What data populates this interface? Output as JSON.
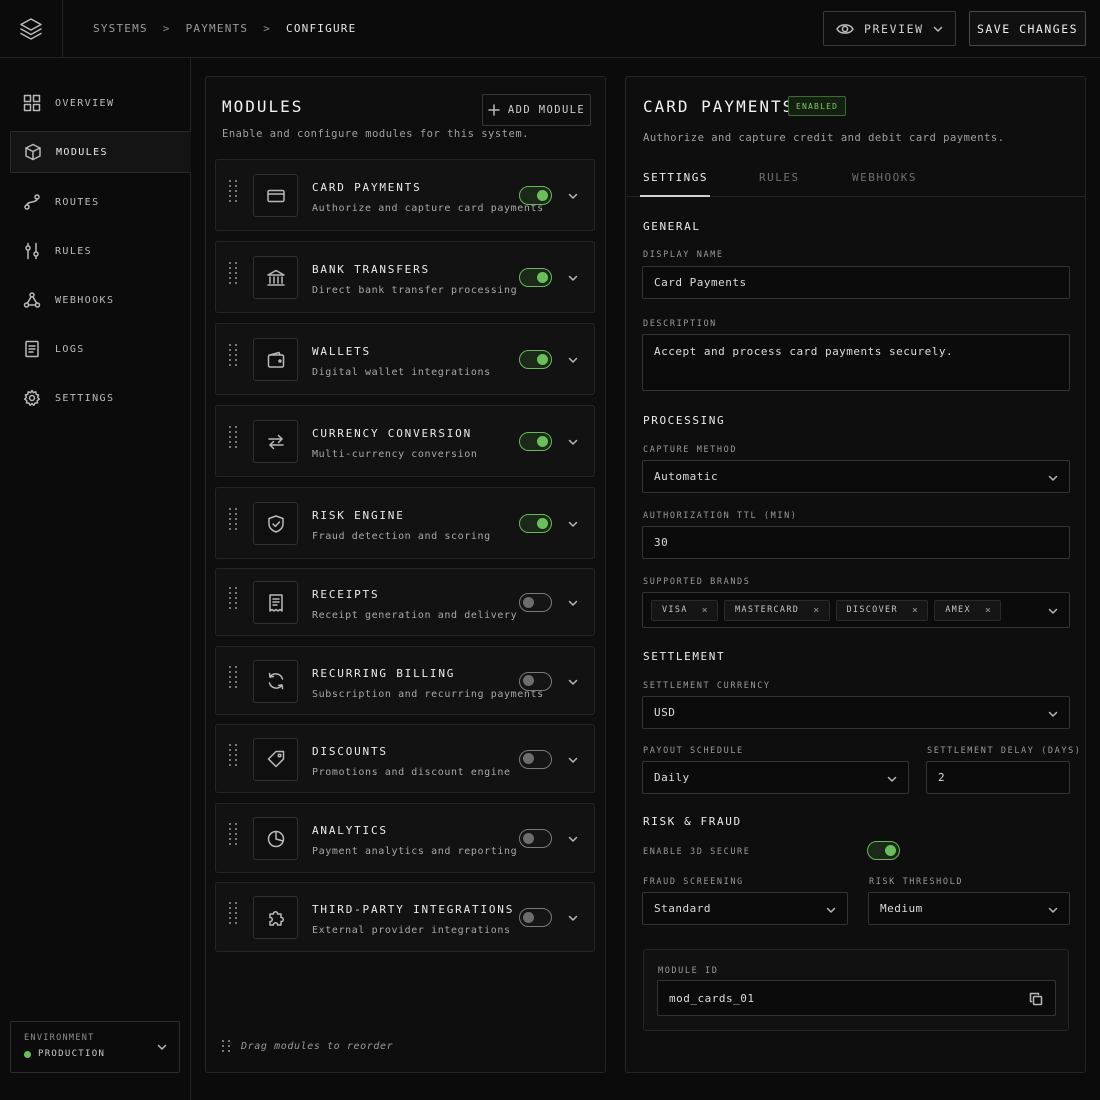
{
  "breadcrumb": [
    "SYSTEMS",
    "PAYMENTS",
    "CONFIGURE"
  ],
  "breadcrumb_sep": ">",
  "header": {
    "preview_label": "PREVIEW",
    "save_label": "SAVE CHANGES"
  },
  "sidebar": {
    "items": [
      {
        "label": "OVERVIEW",
        "icon": "grid-icon"
      },
      {
        "label": "MODULES",
        "icon": "cube-icon"
      },
      {
        "label": "ROUTES",
        "icon": "route-icon"
      },
      {
        "label": "RULES",
        "icon": "sliders-icon"
      },
      {
        "label": "WEBHOOKS",
        "icon": "webhook-icon"
      },
      {
        "label": "LOGS",
        "icon": "document-icon"
      },
      {
        "label": "SETTINGS",
        "icon": "gear-icon"
      }
    ],
    "environment_label": "ENVIRONMENT",
    "environment_value": "PRODUCTION",
    "environment_status_color": "#6bbf59"
  },
  "modules": {
    "title": "MODULES",
    "subtitle": "Enable and configure modules for this system.",
    "add_label": "ADD MODULE",
    "hint": "Drag modules to reorder",
    "items": [
      {
        "name": "CARD PAYMENTS",
        "desc": "Authorize and capture card payments",
        "enabled": true,
        "icon": "credit-card-icon"
      },
      {
        "name": "BANK TRANSFERS",
        "desc": "Direct bank transfer processing",
        "enabled": true,
        "icon": "bank-icon"
      },
      {
        "name": "WALLETS",
        "desc": "Digital wallet integrations",
        "enabled": true,
        "icon": "wallet-icon"
      },
      {
        "name": "CURRENCY CONVERSION",
        "desc": "Multi-currency conversion",
        "enabled": true,
        "icon": "swap-arrows-icon"
      },
      {
        "name": "RISK ENGINE",
        "desc": "Fraud detection and scoring",
        "enabled": true,
        "icon": "shield-check-icon"
      },
      {
        "name": "RECEIPTS",
        "desc": "Receipt generation and delivery",
        "enabled": false,
        "icon": "receipt-icon"
      },
      {
        "name": "RECURRING BILLING",
        "desc": "Subscription and recurring payments",
        "enabled": false,
        "icon": "refresh-icon"
      },
      {
        "name": "DISCOUNTS",
        "desc": "Promotions and discount engine",
        "enabled": false,
        "icon": "tag-icon"
      },
      {
        "name": "ANALYTICS",
        "desc": "Payment analytics and reporting",
        "enabled": false,
        "icon": "pie-chart-icon"
      },
      {
        "name": "THIRD-PARTY INTEGRATIONS",
        "desc": "External provider integrations",
        "enabled": false,
        "icon": "puzzle-icon"
      }
    ]
  },
  "details": {
    "title": "CARD PAYMENTS",
    "badge": "ENABLED",
    "subtitle": "Authorize and capture credit and debit card payments.",
    "tabs": [
      "SETTINGS",
      "RULES",
      "WEBHOOKS"
    ],
    "general": {
      "section": "GENERAL",
      "display_name_label": "DISPLAY NAME",
      "display_name_value": "Card Payments",
      "description_label": "DESCRIPTION",
      "description_value": "Accept and process card payments securely."
    },
    "processing": {
      "section": "PROCESSING",
      "capture_label": "CAPTURE METHOD",
      "capture_value": "Automatic",
      "ttl_label": "AUTHORIZATION TTL (MIN)",
      "ttl_value": "30",
      "brands_label": "SUPPORTED BRANDS",
      "brands": [
        "VISA",
        "MASTERCARD",
        "DISCOVER",
        "AMEX"
      ]
    },
    "settlement": {
      "section": "SETTLEMENT",
      "currency_label": "SETTLEMENT CURRENCY",
      "currency_value": "USD",
      "payout_label": "PAYOUT SCHEDULE",
      "payout_value": "Daily",
      "delay_label": "SETTLEMENT DELAY (DAYS)",
      "delay_value": "2"
    },
    "risk": {
      "section": "RISK & FRAUD",
      "secure_label": "ENABLE 3D SECURE",
      "secure_enabled": true,
      "screening_label": "FRAUD SCREENING",
      "screening_value": "Standard",
      "threshold_label": "RISK THRESHOLD",
      "threshold_value": "Medium"
    },
    "module_id_label": "MODULE ID",
    "module_id_value": "mod_cards_01"
  },
  "colors": {
    "accent_green": "#6bbf59",
    "background": "#0b0b0b",
    "panel": "#0e0e0e"
  }
}
